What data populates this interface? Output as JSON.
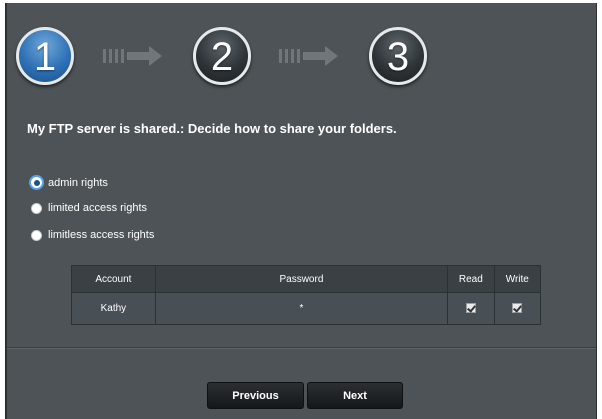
{
  "wizard": {
    "steps": [
      "1",
      "2",
      "3"
    ],
    "active_step": 1
  },
  "title": "My FTP server is shared.: Decide how to share your folders.",
  "rights_options": [
    {
      "label": "admin rights",
      "selected": true
    },
    {
      "label": "limited access rights",
      "selected": false
    },
    {
      "label": "limitless access rights",
      "selected": false
    }
  ],
  "table": {
    "headers": [
      "Account",
      "Password",
      "Read",
      "Write"
    ],
    "rows": [
      {
        "account": "Kathy",
        "password": "*",
        "read": true,
        "write": true
      }
    ]
  },
  "buttons": {
    "previous": "Previous",
    "next": "Next"
  },
  "colors": {
    "panel_bg": "#4d5356",
    "active_step": "#2f71b6",
    "inactive_step": "#2e3438"
  }
}
